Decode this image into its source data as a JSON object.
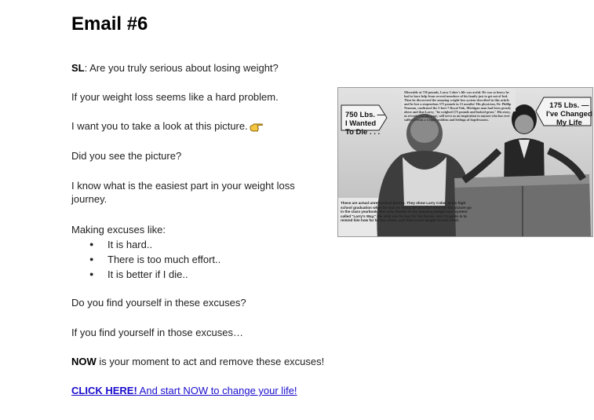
{
  "document": {
    "title": "Email #6",
    "subject_label": "SL",
    "subject_text": ": Are you truly serious about losing weight?",
    "paragraphs": {
      "hard_problem": "If your weight loss seems like a hard problem.",
      "look_picture": "I want you to take a look at this picture.",
      "did_you_see": "Did you see the picture?",
      "easiest_part": "I know what is the easiest part in your weight loss journey.",
      "making_excuses": "Making excuses like:",
      "find_yourself": "Do you find yourself in these excuses?",
      "if_you_find": "If you find yourself in those excuses…",
      "now_label": "NOW",
      "now_text": " is your moment to act and remove these excuses!"
    },
    "excuses": [
      "It is hard..",
      "There is too much effort..",
      "It is better if I die.."
    ],
    "cta": {
      "bold_text": "CLICK HERE!",
      "rest_text": " And start NOW to change your life!"
    }
  },
  "photo": {
    "left_callout": "750 Lbs. —\nI Wanted\nTo Die . . .",
    "right_callout": "175 Lbs. —\nI've Changed\nMy Life",
    "article_text": "Miserable at 750 pounds, Larry Coker's life was awful. He was so heavy he had to have help from several members of his family just to get out of bed. Then he discovered the amazing weight-loss system described in this article and he lost a stupendous 575 pounds in 15 months! His physician, Dr. Phillip Neuman, confirmed the 5-foot-7 Royal Oak, Michigan man had been grossly obese and that Larry, \"he weighed 175 pounds and looked great.\" His story, as revealed on this page, will serve as an inspiration to anyone who has ever suffered from a weight problem and feelings of hopelessness.",
    "caption_text": "These are actual unretouched photos. They show Larry Coker at his high school graduation when he was so heavy he wouldn't even let his picture go in the class yearbook. But now, thanks to his amazing weight-loss system called \"Larry's Way,\" the only use he has for his former size 74 pants is to remind him how far he has come, and how much weight he has shed."
  },
  "icons": {
    "pointing_hand": "backhand-index-pointing-right-icon"
  },
  "colors": {
    "link": "#1a0dcc",
    "text": "#222222",
    "hand_fill": "#f4c542"
  }
}
